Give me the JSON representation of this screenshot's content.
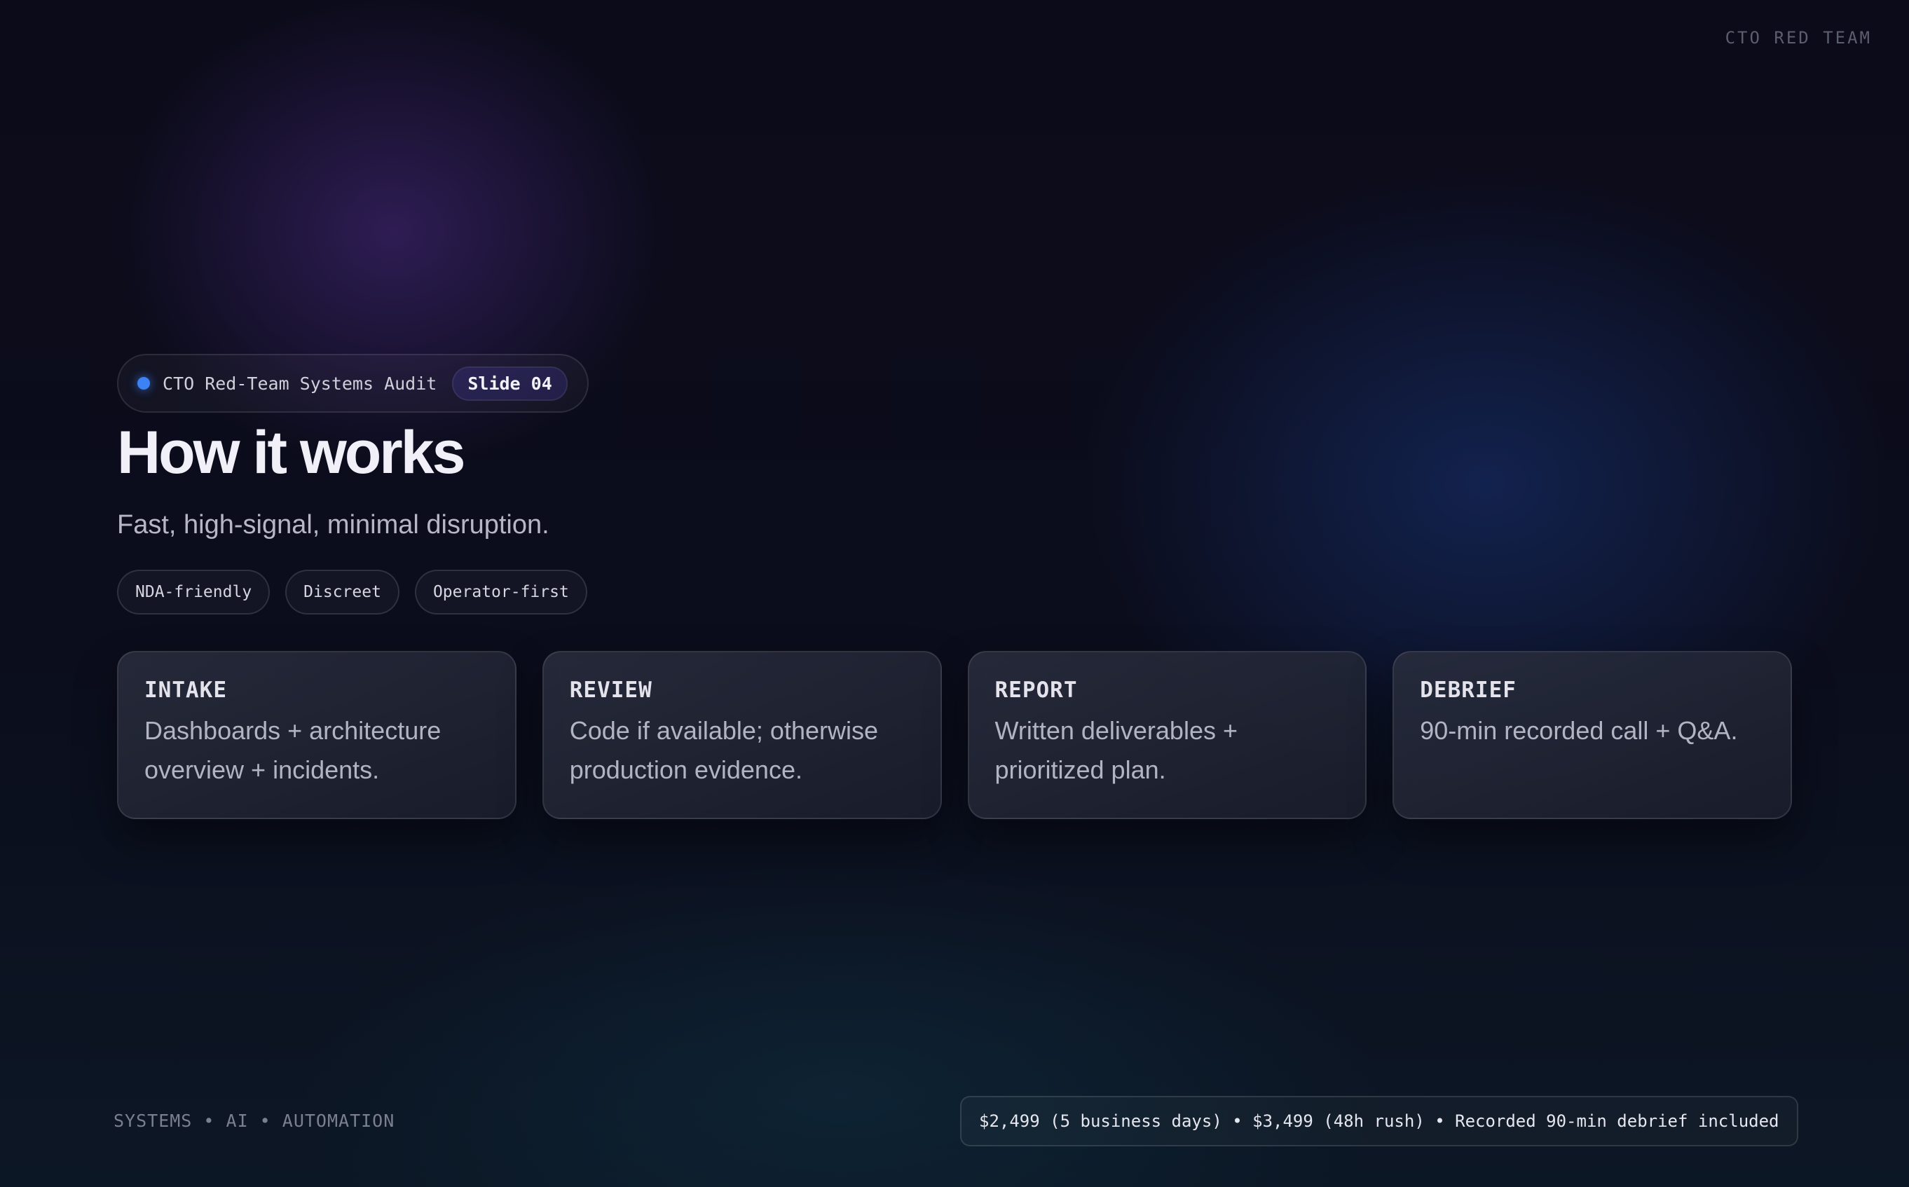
{
  "brand": "CTO RED TEAM",
  "header_pill": {
    "label": "CTO Red-Team Systems Audit",
    "slide": "Slide 04"
  },
  "title": "How it works",
  "subtitle": "Fast, high-signal, minimal disruption.",
  "tags": [
    "NDA-friendly",
    "Discreet",
    "Operator-first"
  ],
  "steps": [
    {
      "title": "INTAKE",
      "body": "Dashboards + architecture overview + incidents."
    },
    {
      "title": "REVIEW",
      "body": "Code if available; otherwise production evidence."
    },
    {
      "title": "REPORT",
      "body": "Written deliverables + prioritized plan."
    },
    {
      "title": "DEBRIEF",
      "body": "90-min recorded call + Q&A."
    }
  ],
  "footer": {
    "tagline": "SYSTEMS • AI • AUTOMATION",
    "pricing": "$2,499 (5 business days) • $3,499 (48h rush) • Recorded 90-min debrief included"
  },
  "colors": {
    "accent_dot": "#3d82f5",
    "background": "#0c0b1a"
  }
}
